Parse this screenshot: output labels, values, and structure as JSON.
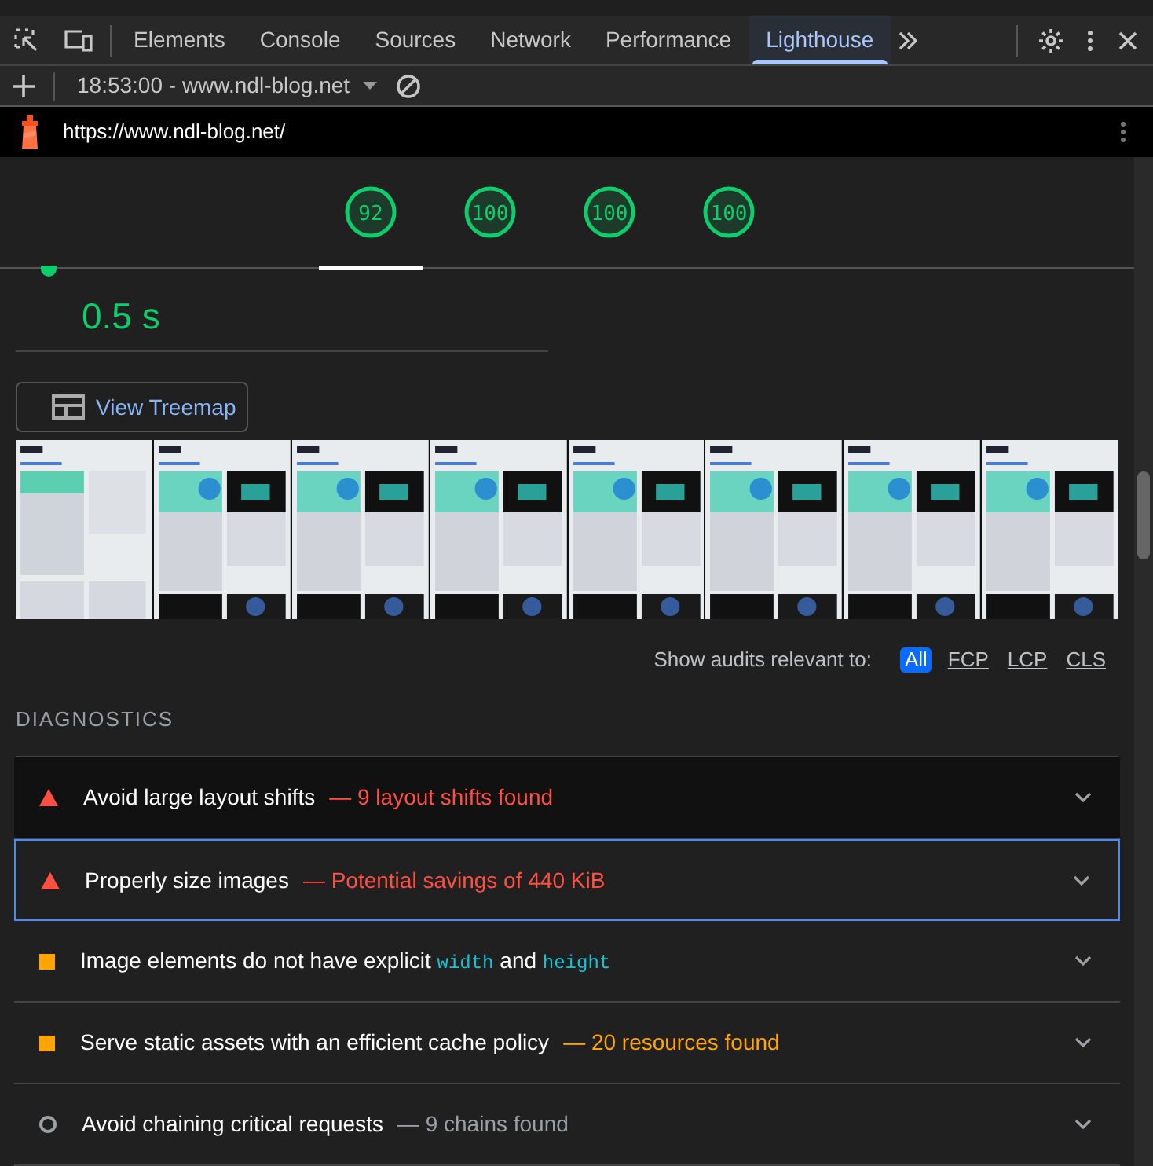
{
  "devtools_tabs": [
    {
      "label": "Elements",
      "selected": false
    },
    {
      "label": "Console",
      "selected": false
    },
    {
      "label": "Sources",
      "selected": false
    },
    {
      "label": "Network",
      "selected": false
    },
    {
      "label": "Performance",
      "selected": false
    },
    {
      "label": "Lighthouse",
      "selected": true
    }
  ],
  "report_selector": {
    "value": "18:53:00 - www.ndl-blog.net"
  },
  "url": "https://www.ndl-blog.net/",
  "scores": [
    {
      "value": "92",
      "selected": true
    },
    {
      "value": "100",
      "selected": false
    },
    {
      "value": "100",
      "selected": false
    },
    {
      "value": "100",
      "selected": false
    }
  ],
  "metric": {
    "value": "0.5 s"
  },
  "treemap_button": "View Treemap",
  "audit_filter": {
    "label": "Show audits relevant to:",
    "options": [
      {
        "label": "All",
        "selected": true
      },
      {
        "label": "FCP",
        "selected": false
      },
      {
        "label": "LCP",
        "selected": false
      },
      {
        "label": "CLS",
        "selected": false
      }
    ]
  },
  "section_title": "DIAGNOSTICS",
  "audits": [
    {
      "kind": "fail",
      "title": [
        {
          "text": "Avoid large layout shifts",
          "code": false
        }
      ],
      "detail": "— 9 layout shifts found",
      "hovered": true,
      "focused": false
    },
    {
      "kind": "fail",
      "title": [
        {
          "text": "Properly size images",
          "code": false
        }
      ],
      "detail": "— Potential savings of 440 KiB",
      "hovered": false,
      "focused": true
    },
    {
      "kind": "average",
      "title": [
        {
          "text": "Image elements do not have explicit ",
          "code": false
        },
        {
          "text": "width",
          "code": true
        },
        {
          "text": " and ",
          "code": false
        },
        {
          "text": "height",
          "code": true
        }
      ],
      "hovered": false,
      "focused": false
    },
    {
      "kind": "average",
      "title": [
        {
          "text": "Serve static assets with an efficient cache policy",
          "code": false
        }
      ],
      "detail": "— 20 resources found",
      "hovered": false,
      "focused": false
    },
    {
      "kind": "info",
      "title": [
        {
          "text": "Avoid chaining critical requests",
          "code": false
        }
      ],
      "detail": "— 9 chains found",
      "hovered": false,
      "focused": false
    }
  ]
}
